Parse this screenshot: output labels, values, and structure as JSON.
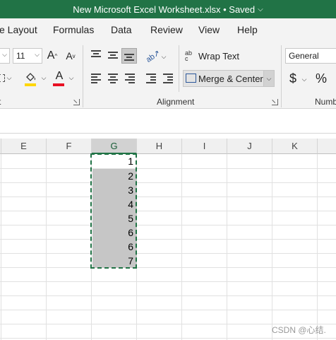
{
  "title_bar": {
    "title": "New Microsoft Excel Worksheet.xlsx • Saved",
    "caret": "⌵"
  },
  "menu": {
    "tabs": [
      "e Layout",
      "Formulas",
      "Data",
      "Review",
      "View",
      "Help"
    ]
  },
  "ribbon": {
    "font_size": "11",
    "grow_font": "A",
    "shrink_font": "A",
    "font_color_glyph": "A",
    "wrap_text": {
      "icon_text": "ab c",
      "label": "Wrap Text"
    },
    "merge_center": {
      "label": "Merge & Center"
    },
    "number_format": "General",
    "currency_symbol": "$",
    "percent_symbol": "%",
    "group_labels": {
      "font_cut": "t",
      "alignment": "Alignment",
      "number_cut": "Numb"
    },
    "colors": {
      "fill_underline": "#ffd600",
      "font_underline": "#e81123"
    }
  },
  "grid": {
    "columns": [
      "E",
      "F",
      "G",
      "H",
      "I",
      "J",
      "K"
    ],
    "selected_column": "G",
    "column_g_values": [
      "1",
      "2",
      "3",
      "4",
      "5",
      "6",
      "6",
      "7"
    ],
    "selection_color": "#217346"
  },
  "watermark": "CSDN @心结."
}
